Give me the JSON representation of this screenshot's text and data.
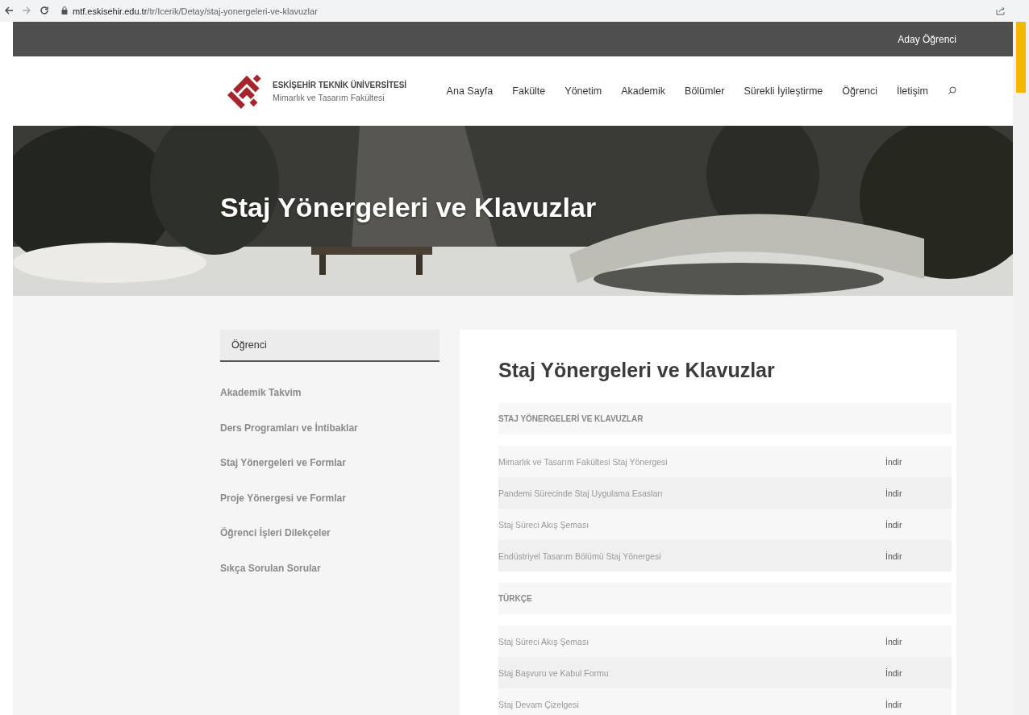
{
  "browser": {
    "url_host": "mtf.eskisehir.edu.tr",
    "url_path": "/tr/Icerik/Detay/staj-yonergeleri-ve-klavuzlar"
  },
  "top_bar": {
    "link": "Aday Öğrenci"
  },
  "header": {
    "logo_title": "ESKİŞEHİR TEKNİK ÜNİVERSİTESİ",
    "logo_subtitle": "Mimarlık ve Tasarım Fakültesi",
    "nav": [
      "Ana Sayfa",
      "Fakülte",
      "Yönetim",
      "Akademik",
      "Bölümler",
      "Sürekli İyileştirme",
      "Öğrenci",
      "İletişim"
    ]
  },
  "hero": {
    "kind": "picture",
    "title": "Staj Yönergeleri ve Klavuzlar"
  },
  "sidebar": {
    "heading": "Öğrenci",
    "items": [
      "Akademik Takvim",
      "Ders Programları ve İntibaklar",
      "Staj Yönergeleri ve Formlar",
      "Proje Yönergesi ve Formlar",
      "Öğrenci İşleri Dilekçeler",
      "Sıkça Sorulan Sorular"
    ]
  },
  "content": {
    "title": "Staj Yönergeleri ve Klavuzlar",
    "sections": [
      {
        "heading": "STAJ YÖNERGELERİ VE KLAVUZLAR",
        "rows": [
          {
            "name": "Mimarlık ve Tasarım Fakültesi Staj Yönergesi",
            "action": "İndir"
          },
          {
            "name": "Pandemi Sürecinde Staj Uygulama Esasları",
            "action": "İndir"
          },
          {
            "name": "Staj Süreci Akış Şeması",
            "action": "İndir"
          },
          {
            "name": "Endüstriyel Tasarım Bölümü Staj Yönergesi",
            "action": "İndir"
          }
        ]
      },
      {
        "heading": "TÜRKÇE",
        "rows": [
          {
            "name": "Staj Süreci Akış Şeması",
            "action": "İndir"
          },
          {
            "name": "Staj Başvuru ve Kabul Formu",
            "action": "İndir"
          },
          {
            "name": "Staj Devam Çizelgesi",
            "action": "İndir"
          }
        ]
      }
    ]
  }
}
